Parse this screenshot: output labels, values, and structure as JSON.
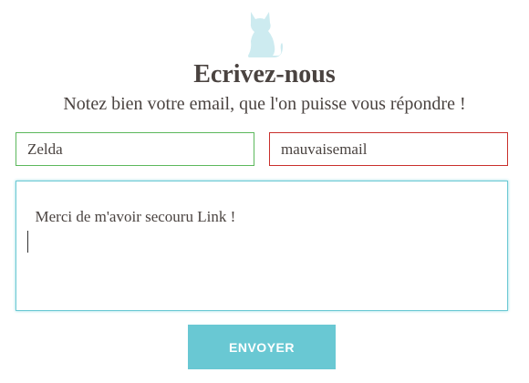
{
  "logo": {
    "icon": "cat-icon",
    "color": "#cdebf0"
  },
  "header": {
    "title": "Ecrivez-nous",
    "subtitle": "Notez bien votre email, que l'on puisse vous répondre !"
  },
  "form": {
    "name_value": "Zelda",
    "email_value": "mauvaisemail",
    "message_value": "Merci de m'avoir secouru Link !",
    "submit_label": "ENVOYER"
  },
  "colors": {
    "valid": "#5cb85c",
    "invalid": "#c9302c",
    "focus": "#6cc9d4",
    "button": "#69c8d3"
  }
}
